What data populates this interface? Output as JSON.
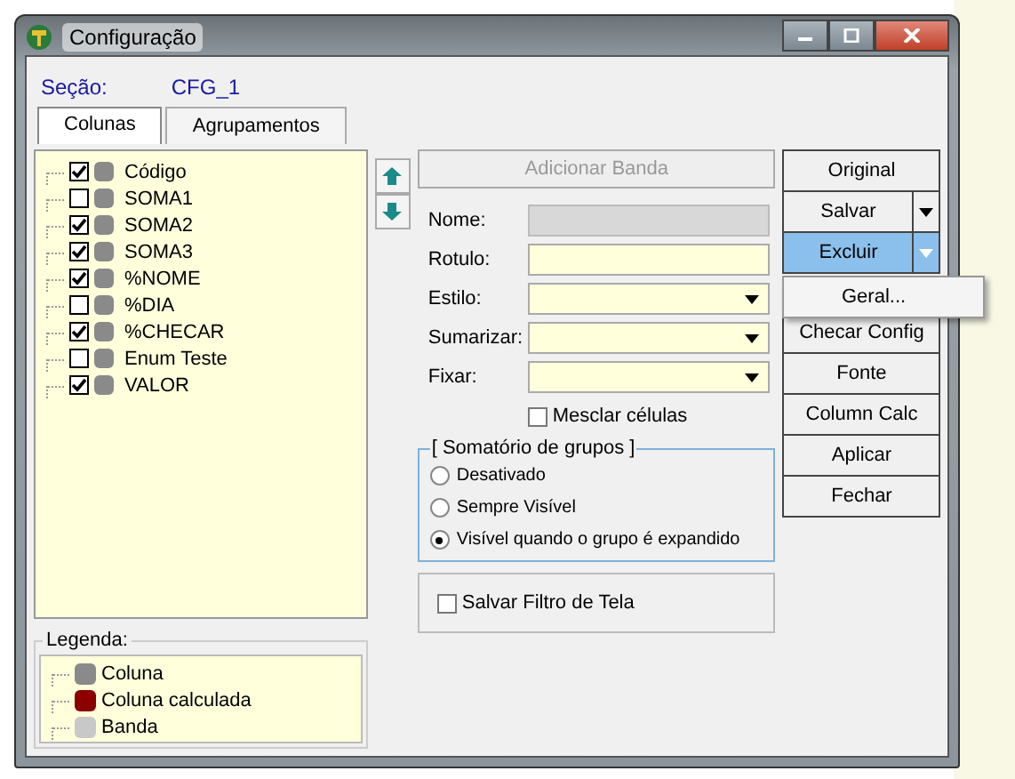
{
  "window": {
    "title": "Configuração"
  },
  "section": {
    "label": "Seção:",
    "value": "CFG_1"
  },
  "tabs": [
    {
      "label": "Colunas",
      "selected": true
    },
    {
      "label": "Agrupamentos",
      "selected": false
    }
  ],
  "columns_tree": [
    {
      "label": "Código",
      "checked": true
    },
    {
      "label": "SOMA1",
      "checked": false
    },
    {
      "label": "SOMA2",
      "checked": true
    },
    {
      "label": "SOMA3",
      "checked": true
    },
    {
      "label": "%NOME",
      "checked": true
    },
    {
      "label": "%DIA",
      "checked": false
    },
    {
      "label": "%CHECAR",
      "checked": true
    },
    {
      "label": "Enum Teste",
      "checked": false
    },
    {
      "label": "VALOR",
      "checked": true
    }
  ],
  "legend": {
    "title": "Legenda:",
    "items": [
      {
        "label": "Coluna",
        "color": "#8a8a8a"
      },
      {
        "label": "Coluna calculada",
        "color": "#8b0000"
      },
      {
        "label": "Banda",
        "color": "#c8c8c8"
      }
    ]
  },
  "add_band_button": {
    "label": "Adicionar Banda",
    "disabled": true
  },
  "fields": [
    {
      "label": "Nome:",
      "kind": "text",
      "disabled": true
    },
    {
      "label": "Rotulo:",
      "kind": "text",
      "disabled": false
    },
    {
      "label": "Estilo:",
      "kind": "combo",
      "disabled": false
    },
    {
      "label": "Sumarizar:",
      "kind": "combo",
      "disabled": false
    },
    {
      "label": "Fixar:",
      "kind": "combo",
      "disabled": false
    }
  ],
  "merge_cells": {
    "label": "Mesclar células",
    "checked": false
  },
  "group_totals": {
    "title": "[ Somatório de grupos ]",
    "options": [
      {
        "label": "Desativado",
        "selected": false
      },
      {
        "label": "Sempre Visível",
        "selected": false
      },
      {
        "label": "Visível quando o grupo é expandido",
        "selected": true
      }
    ]
  },
  "save_filter": {
    "label": "Salvar Filtro de Tela",
    "checked": false
  },
  "buttons": [
    {
      "label": "Original",
      "kind": "button",
      "highlighted": false
    },
    {
      "label": "Salvar",
      "kind": "split",
      "highlighted": false
    },
    {
      "label": "Excluir",
      "kind": "split",
      "highlighted": true
    },
    {
      "label": "Checar Config",
      "kind": "button",
      "highlighted": false
    },
    {
      "label": "Fonte",
      "kind": "button",
      "highlighted": false
    },
    {
      "label": "Column Calc",
      "kind": "button",
      "highlighted": false
    },
    {
      "label": "Aplicar",
      "kind": "button",
      "highlighted": false
    },
    {
      "label": "Fechar",
      "kind": "button",
      "highlighted": false
    }
  ],
  "popup_menu": {
    "items": [
      {
        "label": "Geral..."
      }
    ]
  }
}
